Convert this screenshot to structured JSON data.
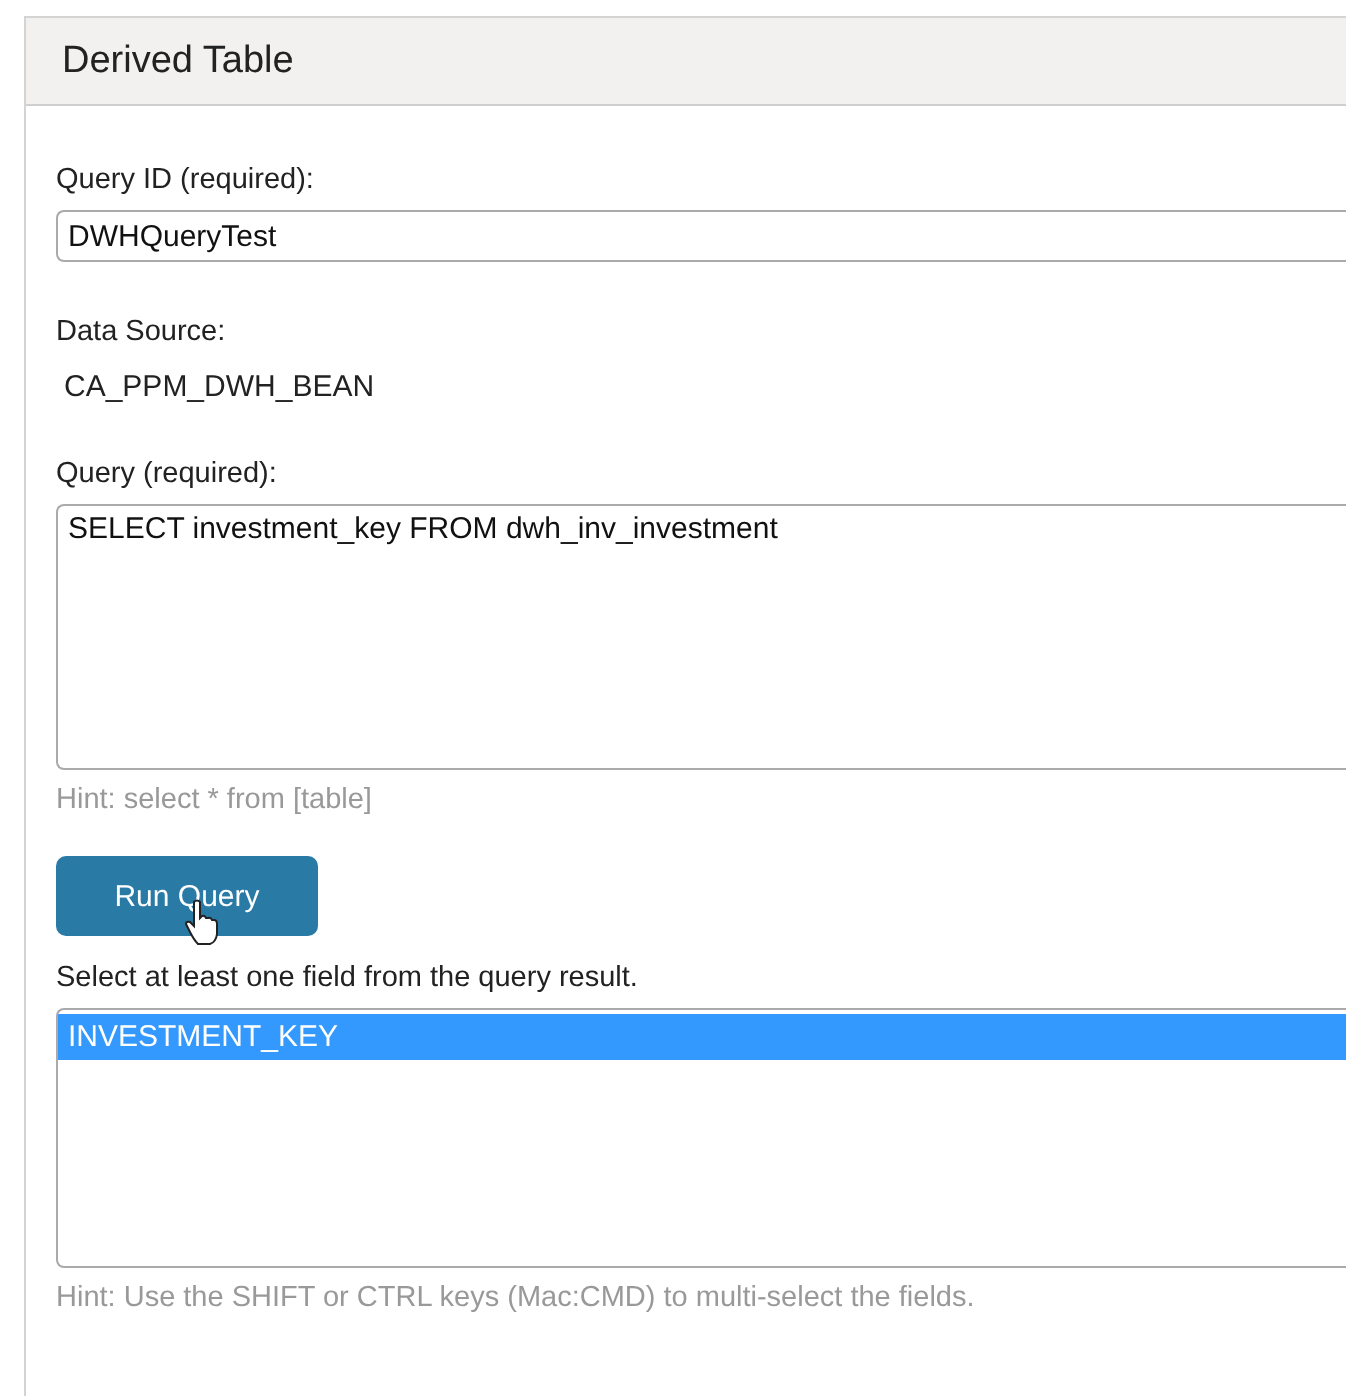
{
  "panel": {
    "title": "Derived Table"
  },
  "query_id": {
    "label": "Query ID (required):",
    "value": "DWHQueryTest"
  },
  "data_source": {
    "label": "Data Source:",
    "value": "CA_PPM_DWH_BEAN"
  },
  "query": {
    "label": "Query (required):",
    "value": "SELECT investment_key FROM dwh_inv_investment",
    "hint": "Hint: select * from [table]"
  },
  "run_button": {
    "label": "Run Query"
  },
  "fields": {
    "label": "Select at least one field from the query result.",
    "options": [
      {
        "label": "INVESTMENT_KEY",
        "selected": true
      }
    ],
    "hint": "Hint: Use the SHIFT or CTRL keys (Mac:CMD) to multi-select the fields."
  }
}
